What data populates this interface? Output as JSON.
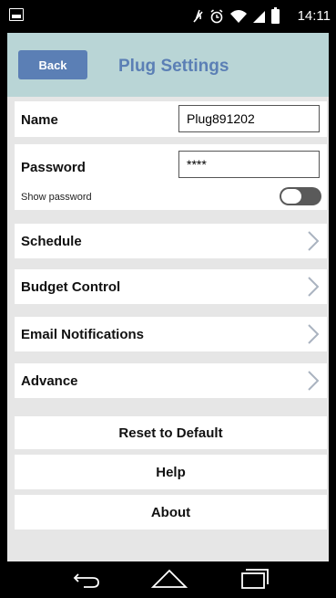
{
  "status_bar": {
    "time": "14:11",
    "icons": [
      "screenshot-icon",
      "mute-icon",
      "alarm-icon",
      "wifi-icon",
      "signal-icon",
      "battery-icon"
    ]
  },
  "header": {
    "back_label": "Back",
    "title": "Plug Settings",
    "background_color": "#b9d5d6",
    "accent_color": "#5b7fb5"
  },
  "form": {
    "name_label": "Name",
    "name_value": "Plug891202",
    "password_label": "Password",
    "password_value": "****",
    "show_password_label": "Show password",
    "show_password_on": false
  },
  "menu": [
    {
      "label": "Schedule"
    },
    {
      "label": "Budget Control"
    },
    {
      "label": "Email Notifications"
    },
    {
      "label": "Advance"
    }
  ],
  "actions": [
    {
      "label": "Reset to Default"
    },
    {
      "label": "Help"
    },
    {
      "label": "About"
    }
  ]
}
